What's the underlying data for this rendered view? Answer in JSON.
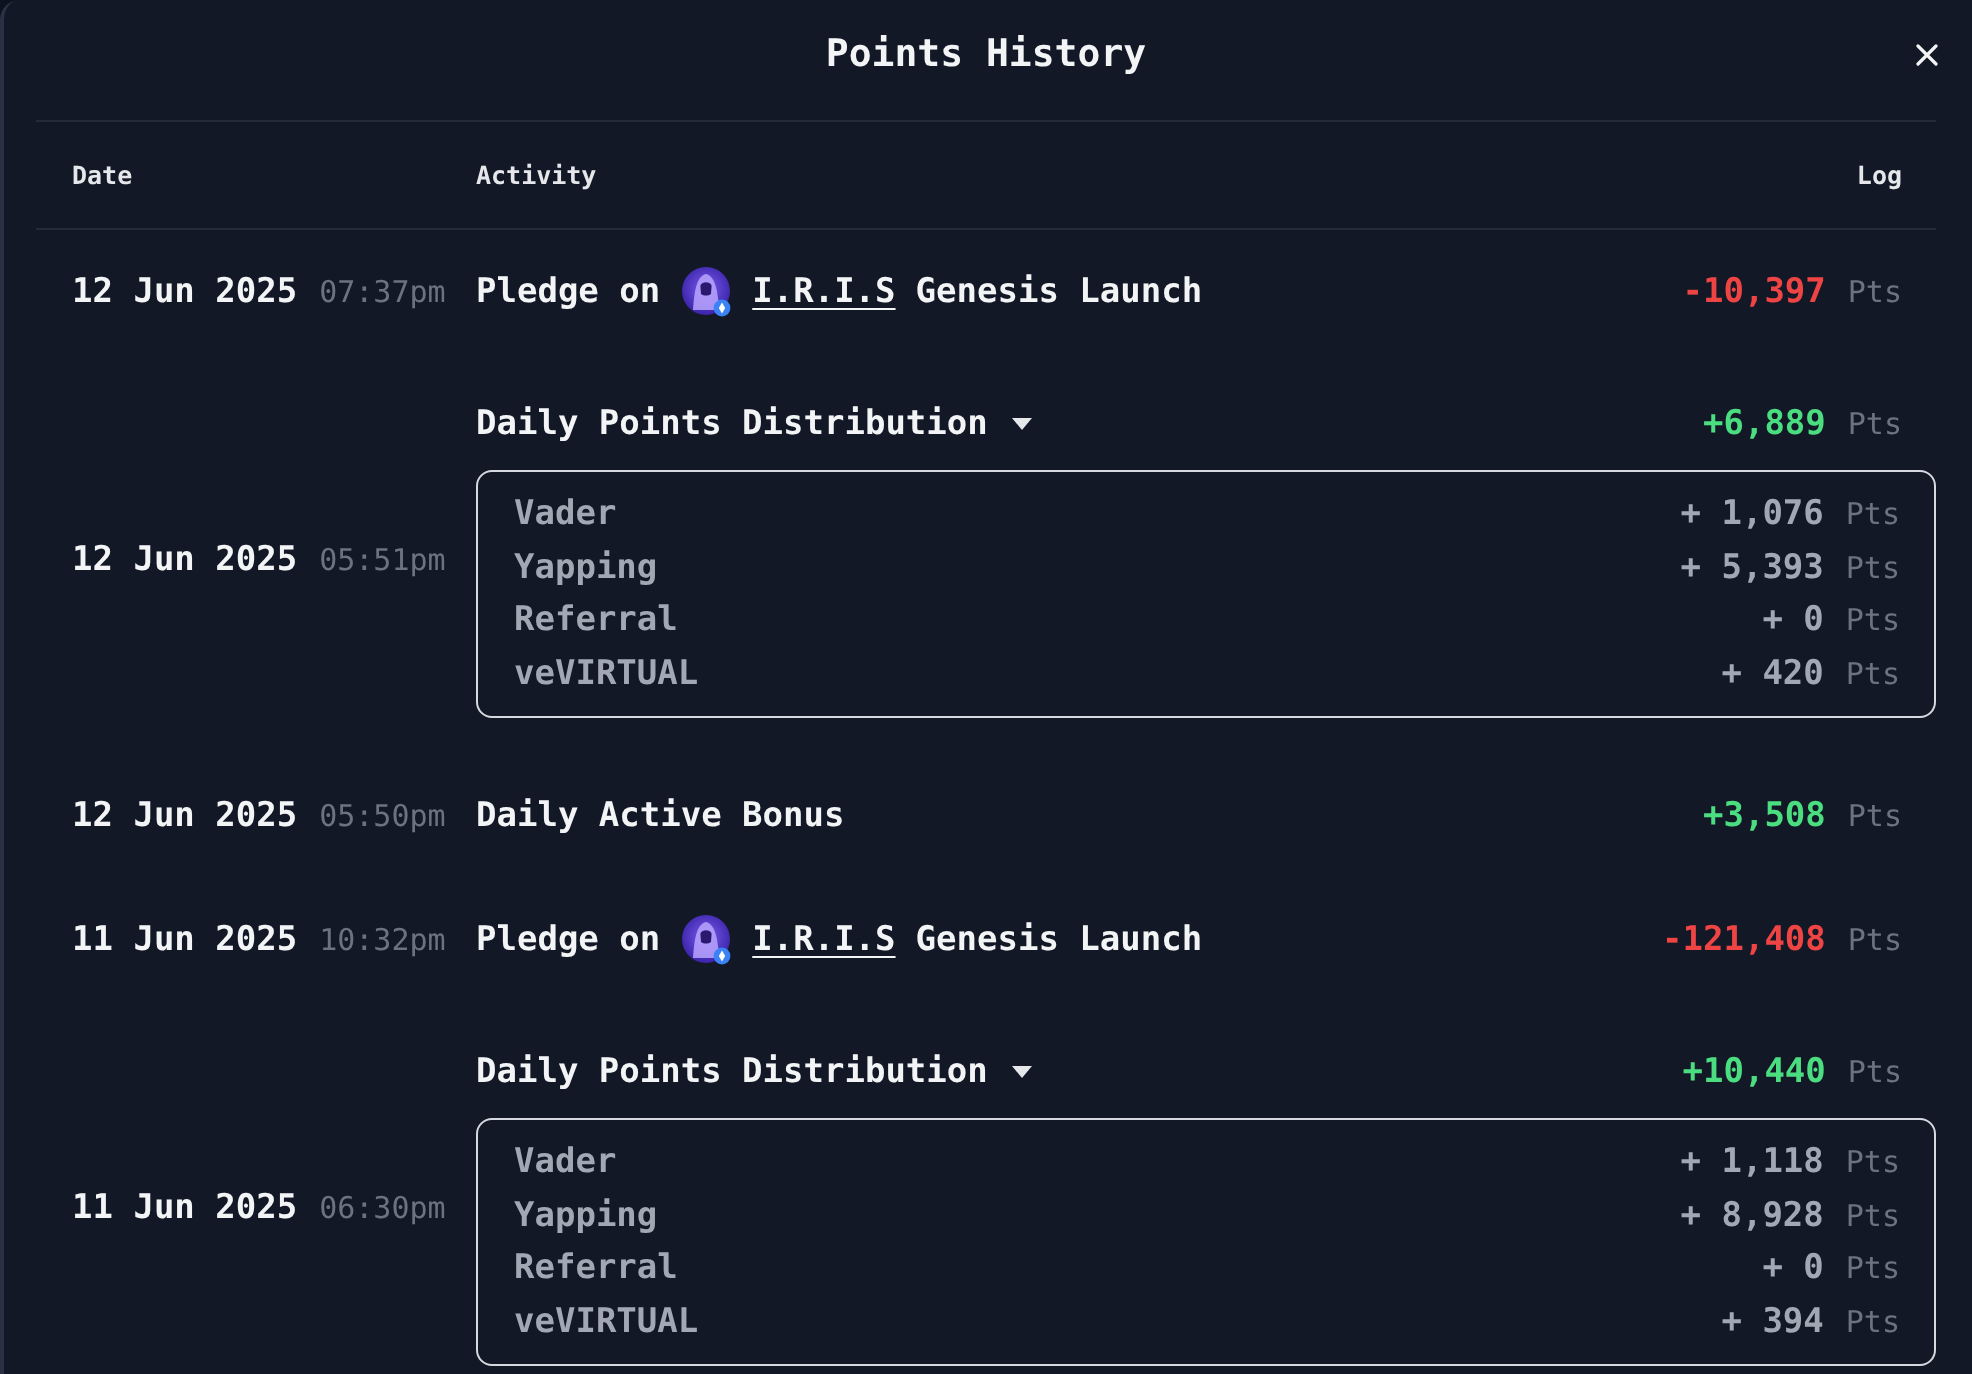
{
  "dialog": {
    "title": "Points History"
  },
  "table": {
    "columns": [
      "Date",
      "Activity",
      "Log"
    ],
    "rows": [
      {
        "kind": "pledge",
        "date": "12 Jun 2025",
        "time": "07:37pm",
        "prefix": "Pledge on",
        "link": "I.R.I.S",
        "suffix": "Genesis Launch",
        "amount": "-10,397",
        "unit": "Pts",
        "color": "#ef4444"
      },
      {
        "kind": "distribution",
        "date": "12 Jun 2025",
        "time": "05:51pm",
        "title": "Daily Points Distribution",
        "expanded": true,
        "amount": "+6,889",
        "unit": "Pts",
        "color": "#4ade80",
        "breakdown": [
          {
            "label": "Vader",
            "amount": "+ 1,076",
            "unit": "Pts"
          },
          {
            "label": "Yapping",
            "amount": "+ 5,393",
            "unit": "Pts"
          },
          {
            "label": "Referral",
            "amount": "+ 0",
            "unit": "Pts"
          },
          {
            "label": "veVIRTUAL",
            "amount": "+ 420",
            "unit": "Pts"
          }
        ]
      },
      {
        "kind": "bonus",
        "date": "12 Jun 2025",
        "time": "05:50pm",
        "title": "Daily Active Bonus",
        "amount": "+3,508",
        "unit": "Pts",
        "color": "#4ade80"
      },
      {
        "kind": "pledge",
        "date": "11 Jun 2025",
        "time": "10:32pm",
        "prefix": "Pledge on",
        "link": "I.R.I.S",
        "suffix": "Genesis Launch",
        "amount": "-121,408",
        "unit": "Pts",
        "color": "#ef4444"
      },
      {
        "kind": "distribution",
        "date": "11 Jun 2025",
        "time": "06:30pm",
        "title": "Daily Points Distribution",
        "expanded": true,
        "amount": "+10,440",
        "unit": "Pts",
        "color": "#4ade80",
        "breakdown": [
          {
            "label": "Vader",
            "amount": "+ 1,118",
            "unit": "Pts"
          },
          {
            "label": "Yapping",
            "amount": "+ 8,928",
            "unit": "Pts"
          },
          {
            "label": "Referral",
            "amount": "+ 0",
            "unit": "Pts"
          },
          {
            "label": "veVIRTUAL",
            "amount": "+ 394",
            "unit": "Pts"
          }
        ]
      }
    ]
  }
}
